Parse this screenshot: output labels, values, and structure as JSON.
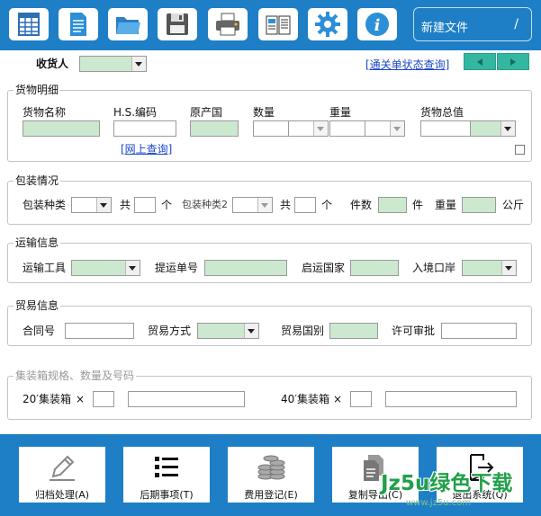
{
  "toolbar": {
    "icons": [
      "spreadsheet-icon",
      "document-icon",
      "folder-open-icon",
      "save-disk-icon",
      "printer-icon",
      "book-icon",
      "gear-icon",
      "info-icon"
    ],
    "new_file_label": "新建文件",
    "new_file_mark": "/"
  },
  "header": {
    "consignee_label": "收货人",
    "status_link": "[通关单状态查询]"
  },
  "goods": {
    "title": "货物明细",
    "name_label": "货物名称",
    "hs_label": "H.S.编码",
    "origin_label": "原产国",
    "qty_label": "数量",
    "weight_label": "重量",
    "total_label": "货物总值",
    "online_link": "[网上查询]"
  },
  "packing": {
    "title": "包装情况",
    "type_label": "包装种类",
    "total_label": "共",
    "unit_label": "个",
    "type2_label": "包装种类2",
    "total2_label": "共",
    "unit2_label": "个",
    "pieces_label": "件数",
    "pieces_unit": "件",
    "weight_label": "重量",
    "weight_unit": "公斤"
  },
  "transport": {
    "title": "运输信息",
    "tool_label": "运输工具",
    "bill_label": "提运单号",
    "country_label": "启运国家",
    "port_label": "入境口岸"
  },
  "trade": {
    "title": "贸易信息",
    "contract_label": "合同号",
    "mode_label": "贸易方式",
    "country_label": "贸易国别",
    "permit_label": "许可审批"
  },
  "container": {
    "title": "集装箱规格、数量及号码",
    "c20_label": "20′集装箱",
    "c40_label": "40′集装箱",
    "times": "×"
  },
  "bottom": {
    "buttons": [
      {
        "label": "归档处理(A)",
        "icon": "pencil-icon"
      },
      {
        "label": "后期事项(T)",
        "icon": "list-icon"
      },
      {
        "label": "费用登记(E)",
        "icon": "coins-icon"
      },
      {
        "label": "复制导出(C)",
        "icon": "copy-export-icon"
      },
      {
        "label": "退出系统(Q)",
        "icon": "exit-icon"
      }
    ]
  },
  "watermark": {
    "text": "Jz5u绿色下载",
    "sub": "www.jz5u.com"
  },
  "colors": {
    "blue": "#1e7fc6",
    "green_field": "#cce8cf",
    "nav_teal": "#33b7a0",
    "link": "#1a46c8"
  }
}
